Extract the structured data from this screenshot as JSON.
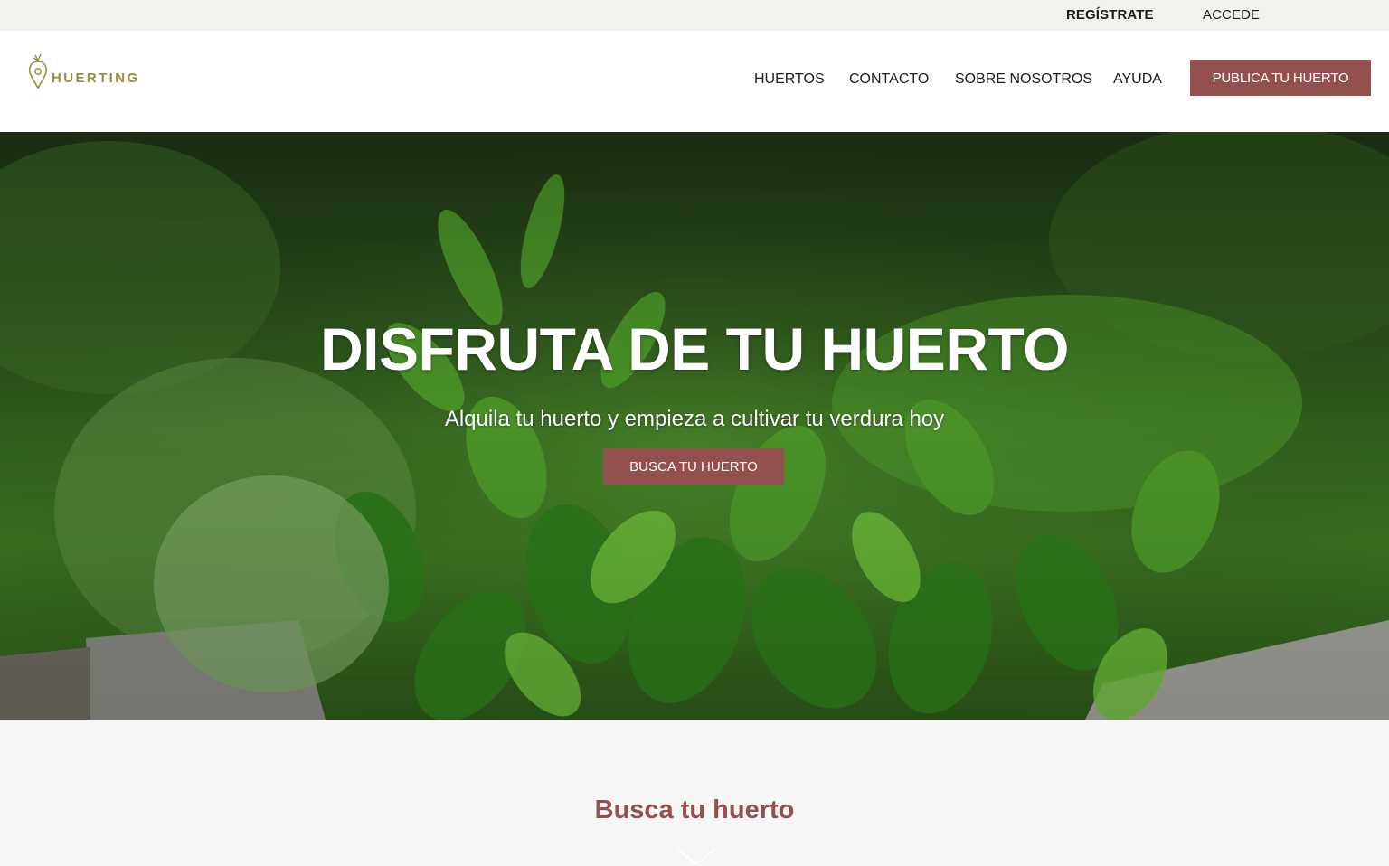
{
  "topbar": {
    "register": "REGÍSTRATE",
    "login": "ACCEDE"
  },
  "header": {
    "logo_text": "HUERTING",
    "nav": [
      "HUERTOS",
      "CONTACTO",
      "SOBRE NOSOTROS",
      "AYUDA"
    ],
    "publish_button": "PUBLICA TU HUERTO"
  },
  "hero": {
    "title": "DISFRUTA DE TU HUERTO",
    "subtitle": "Alquila tu huerto y empieza a cultivar tu verdura hoy",
    "button": "BUSCA TU HUERTO"
  },
  "search_section": {
    "title": "Busca tu huerto"
  },
  "colors": {
    "accent": "#93504f",
    "logo_gold": "#a08a3c",
    "topbar_bg": "#f3f1ec"
  },
  "icons": {
    "logo": "map-pin-carrot-icon",
    "scroll": "chevron-down-icon"
  }
}
